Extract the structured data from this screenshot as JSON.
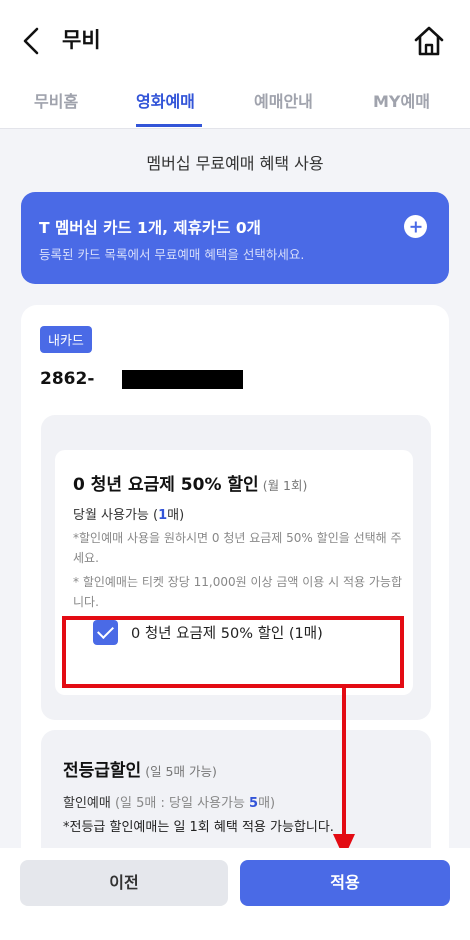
{
  "header": {
    "title": "무비"
  },
  "tabs": [
    {
      "label": "무비홈"
    },
    {
      "label": "영화예매"
    },
    {
      "label": "예매안내"
    },
    {
      "label": "MY예매"
    }
  ],
  "section": {
    "title": "멤버십 무료예매 혜택 사용"
  },
  "banner": {
    "title": "T 멤버십 카드 1개, 제휴카드 0개",
    "subtitle": "등록된 카드 목록에서 무료예매 혜택을 선택하세요."
  },
  "card": {
    "badge": "내카드",
    "number_prefix": "2862-"
  },
  "benefit1": {
    "title": "0 청년 요금제 50% 할인",
    "title_sub": "(월 1회)",
    "usage_prefix": "당월 사용가능 (",
    "usage_count": "1",
    "usage_suffix": "매)",
    "note1": "*할인예매 사용을 원하시면 0 청년 요금제 50% 할인을 선택해 주세요.",
    "note2": "* 할인예매는 티켓 장당 11,000원 이상 금액 이용 시 적용 가능합니다.",
    "checkbox_label": "0 청년 요금제 50% 할인 (1매)"
  },
  "benefit2": {
    "title": "전등급할인",
    "title_sub": "(일 5매 가능)",
    "usage_label": "할인예매",
    "usage_detail_prefix": " (일 5매 : 당일 사용가능 ",
    "usage_count": "5",
    "usage_detail_suffix": "매)",
    "note": "*전등급 할인예매는 일 1회 혜택 적용 가능합니다."
  },
  "buttons": {
    "prev": "이전",
    "apply": "적용"
  }
}
